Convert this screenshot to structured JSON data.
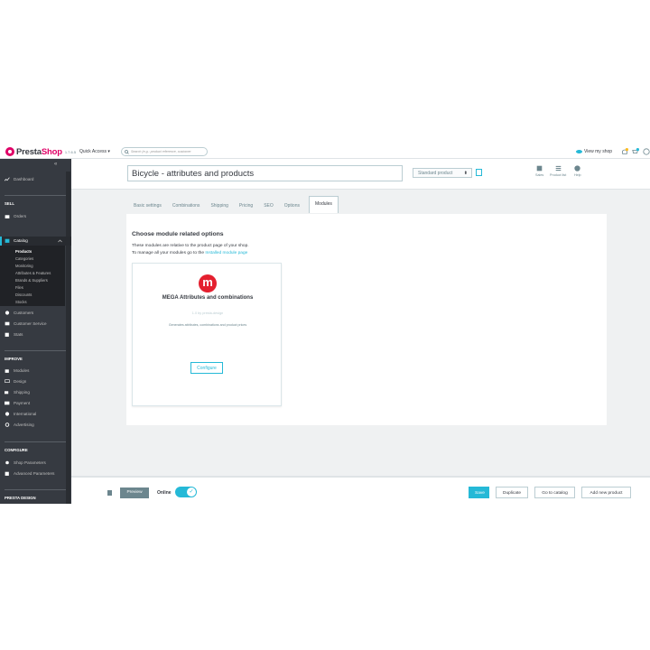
{
  "colors": {
    "accent": "#25b9d7",
    "brand": "#df0067",
    "sidebar": "#363a41"
  },
  "header": {
    "logo_text_a": "Presta",
    "logo_text_b": "Shop",
    "version": "1.7.6.5",
    "quick_access": "Quick Access ▾",
    "search_placeholder": "Search (e.g.: product reference, customer",
    "view_my_shop": "View my shop"
  },
  "sidebar": {
    "collapse": "«",
    "dashboard": "Dashboard",
    "sell_section": "SELL",
    "orders": "Orders",
    "catalog": "Catalog",
    "catalog_items": [
      "Products",
      "Categories",
      "Monitoring",
      "Attributes & Features",
      "Brands & Suppliers",
      "Files",
      "Discounts",
      "Stocks"
    ],
    "customers": "Customers",
    "customer_service": "Customer Service",
    "stats": "Stats",
    "improve_section": "IMPROVE",
    "improve_items": [
      "Modules",
      "Design",
      "Shipping",
      "Payment",
      "International",
      "Advertising"
    ],
    "configure_section": "CONFIGURE",
    "configure_items": [
      "Shop Parameters",
      "Advanced Parameters"
    ],
    "presta_design": "PRESTA DESIGN"
  },
  "product": {
    "name": "Bicycle - attributes and products",
    "type": "Standard product",
    "actions": {
      "sales": "Sales",
      "product_list": "Product list",
      "help": "Help"
    }
  },
  "tabs": [
    "Basic settings",
    "Combinations",
    "Shipping",
    "Pricing",
    "SEO",
    "Options",
    "Modules"
  ],
  "modules_panel": {
    "title": "Choose module related options",
    "desc1": "These modules are relative to the product page of your shop.",
    "desc2_prefix": "To manage all your modules go to the ",
    "desc2_link": "Installed module page",
    "module": {
      "logo_letter": "m",
      "name": "MEGA Attributes and combinations",
      "version": "1.0 by presta-design",
      "description": "Generates attributes, combinations and product prices",
      "configure": "Configure"
    }
  },
  "footer": {
    "preview": "Preview",
    "online": "Online",
    "online_on": true,
    "save": "Save",
    "duplicate": "Duplicate",
    "go_to_catalog": "Go to catalog",
    "add_new_product": "Add new product"
  }
}
